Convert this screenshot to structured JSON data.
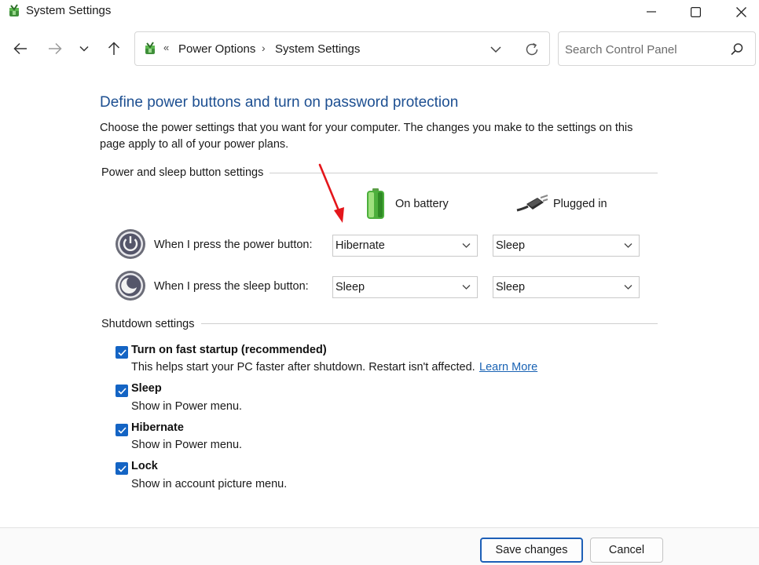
{
  "window": {
    "title": "System Settings"
  },
  "addressbar": {
    "overflow": "«",
    "crumbs": [
      "Power Options",
      "System Settings"
    ],
    "separator": "›"
  },
  "search": {
    "placeholder": "Search Control Panel"
  },
  "main": {
    "heading": "Define power buttons and turn on password protection",
    "description": "Choose the power settings that you want for your computer. The changes you make to the settings on this page apply to all of your power plans.",
    "power_group_label": "Power and sleep button settings",
    "columns": {
      "on_battery": "On battery",
      "plugged_in": "Plugged in"
    },
    "rows": [
      {
        "label": "When I press the power button:",
        "on_battery": "Hibernate",
        "plugged_in": "Sleep"
      },
      {
        "label": "When I press the sleep button:",
        "on_battery": "Sleep",
        "plugged_in": "Sleep"
      }
    ],
    "shutdown_group_label": "Shutdown settings",
    "shutdown": [
      {
        "title": "Turn on fast startup (recommended)",
        "subtitle": "This helps start your PC faster after shutdown. Restart isn't affected.",
        "link": "Learn More",
        "checked": true
      },
      {
        "title": "Sleep",
        "subtitle": "Show in Power menu.",
        "checked": true
      },
      {
        "title": "Hibernate",
        "subtitle": "Show in Power menu.",
        "checked": true
      },
      {
        "title": "Lock",
        "subtitle": "Show in account picture menu.",
        "checked": true
      }
    ]
  },
  "footer": {
    "save_label": "Save changes",
    "cancel_label": "Cancel"
  },
  "colors": {
    "heading": "#1d4f91",
    "checkbox": "#1464c4",
    "link": "#1a63b4",
    "annotation_arrow": "#e4161b"
  }
}
